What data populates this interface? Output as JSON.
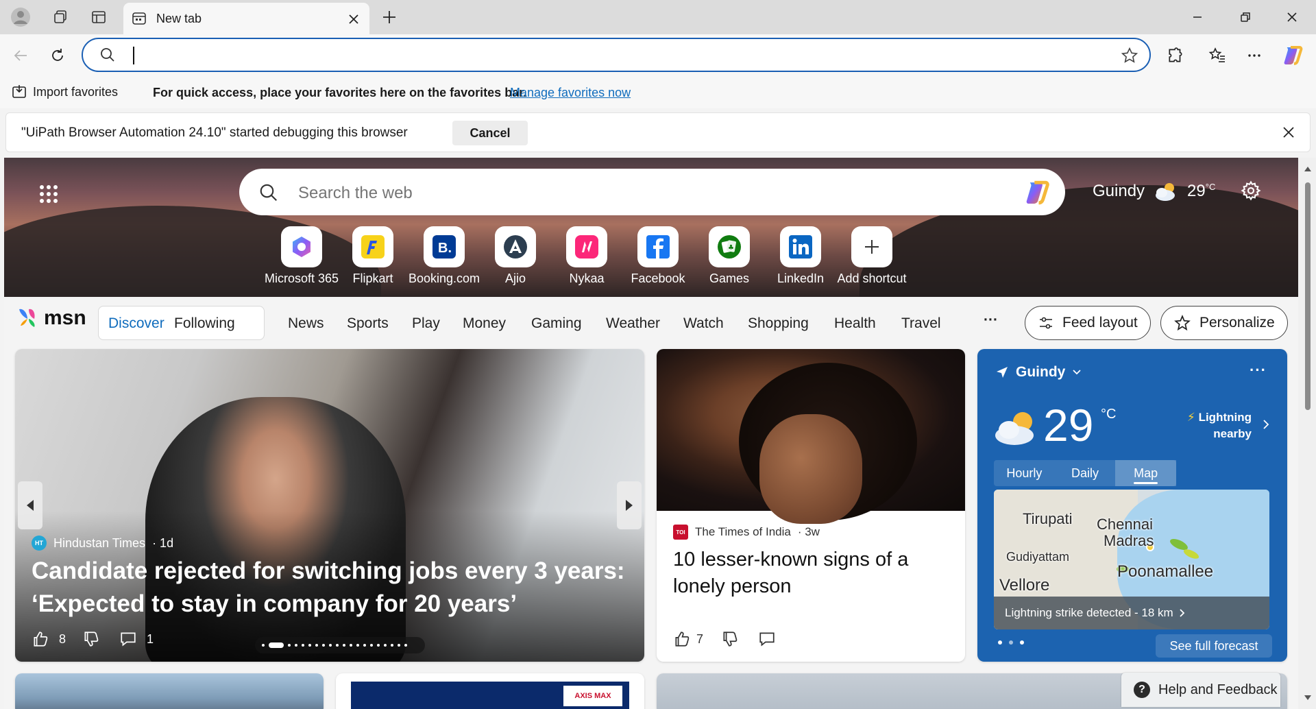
{
  "browser": {
    "tab_title": "New tab",
    "address_value": "",
    "address_placeholder": ""
  },
  "favorites_bar": {
    "import_label": "Import favorites",
    "message": "For quick access, place your favorites here on the favorites bar.",
    "manage_link": "Manage favorites now"
  },
  "infobar": {
    "message": "\"UiPath Browser Automation 24.10\" started debugging this browser",
    "cancel_label": "Cancel"
  },
  "hero": {
    "search_placeholder": "Search the web",
    "location": "Guindy",
    "temperature": "29",
    "temperature_unit": "°C"
  },
  "shortcuts": [
    {
      "label": "Microsoft 365",
      "icon": "microsoft-365-icon",
      "color": "#7b5cf5"
    },
    {
      "label": "Flipkart",
      "icon": "flipkart-icon",
      "color": "#f7d21a"
    },
    {
      "label": "Booking.com",
      "icon": "booking-icon",
      "color": "#003b95"
    },
    {
      "label": "Ajio",
      "icon": "ajio-icon",
      "color": "#2c3e50"
    },
    {
      "label": "Nykaa",
      "icon": "nykaa-icon",
      "color": "#fc2779"
    },
    {
      "label": "Facebook",
      "icon": "facebook-icon",
      "color": "#1877f2"
    },
    {
      "label": "Games",
      "icon": "games-icon",
      "color": "#107c10"
    },
    {
      "label": "LinkedIn",
      "icon": "linkedin-icon",
      "color": "#0a66c2"
    },
    {
      "label": "Add shortcut",
      "icon": "plus-icon",
      "color": "#333333"
    }
  ],
  "msn": {
    "logo_text": "msn",
    "pills": [
      "Discover",
      "Following"
    ],
    "nav": [
      "News",
      "Sports",
      "Play",
      "Money",
      "Gaming",
      "Weather",
      "Watch",
      "Shopping",
      "Health",
      "Travel"
    ],
    "more": "···",
    "feed_layout": "Feed layout",
    "personalize": "Personalize"
  },
  "main_story": {
    "source": "Hindustan Times",
    "source_badge": "HT",
    "age": "· 1d",
    "title": "Candidate rejected for switching jobs every 3 years: ‘Expected to stay in company for 20 years’",
    "likes": "8",
    "comments": "1"
  },
  "news_story": {
    "source": "The Times of India",
    "source_badge": "TOI",
    "age": "· 3w",
    "title": "10 lesser-known signs of a lonely person",
    "likes": "7"
  },
  "weather": {
    "location": "Guindy",
    "temperature": "29",
    "unit": "°C",
    "alert_line1": "Lightning",
    "alert_line2": "nearby",
    "tabs": [
      "Hourly",
      "Daily",
      "Map"
    ],
    "active_tab": "Map",
    "map_labels": [
      "Tirupati",
      "Chennai",
      "Madras",
      "Gudiyattam",
      "Poonamallee",
      "Vellore"
    ],
    "map_footer": "Lightning strike detected - 18 km",
    "see_forecast": "See full forecast",
    "more": "···"
  },
  "help": {
    "label": "Help and Feedback",
    "icon_glyph": "?"
  },
  "colors": {
    "accent": "#0f6cbd",
    "omnibox_border": "#1a5fb4",
    "weather_card": "#1c63b0"
  }
}
